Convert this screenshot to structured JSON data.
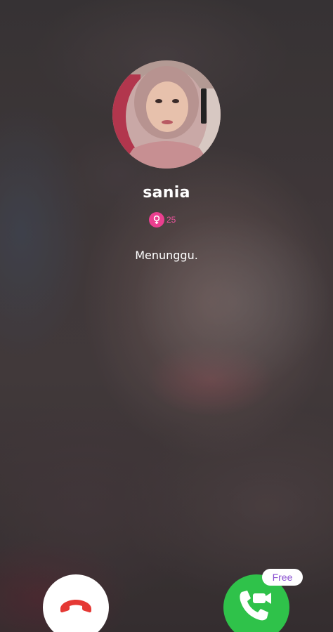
{
  "caller": {
    "name": "sania",
    "age": "25",
    "gender_icon": "female-icon",
    "avatar_icon": "avatar"
  },
  "call": {
    "status": "Menunggu."
  },
  "actions": {
    "decline_icon": "phone-hangup-icon",
    "accept_icon": "video-call-icon",
    "accept_tag": "Free"
  },
  "colors": {
    "accent_pink": "#ea3f8f",
    "accept_green": "#2fc24a",
    "decline_red": "#e53935",
    "free_text": "#8a4fd0"
  }
}
